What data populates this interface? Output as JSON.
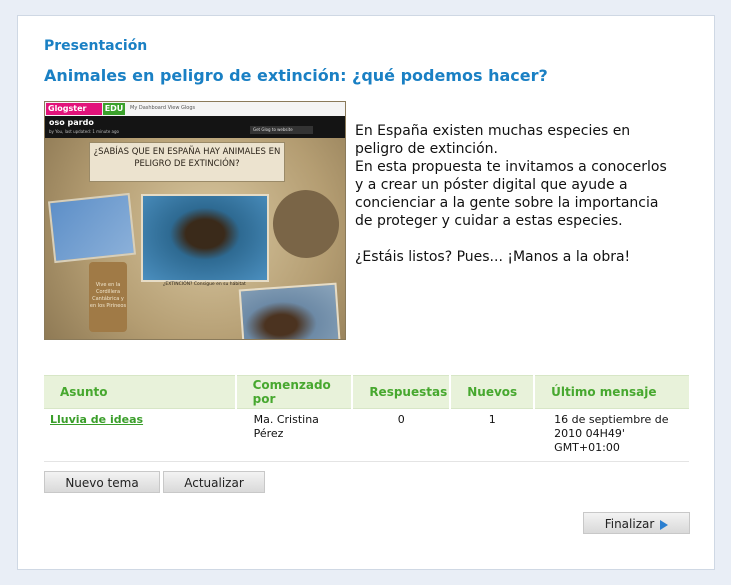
{
  "section": {
    "title": "Presentación"
  },
  "activity": {
    "title": "Animales en peligro de extinción: ¿qué podemos hacer?"
  },
  "poster": {
    "logo_text": "Glogster",
    "edu_text": "EDU",
    "nav_text": "My Dashboard   View Glogs",
    "glog_name": "oso pardo",
    "byline": "by You, last updated: 1 minute ago",
    "get_code": "Get Glog to website",
    "question": "¿SABÍAS QUE EN ESPAÑA HAY ANIMALES EN PELIGRO DE EXTINCIÓN?",
    "tag_text": "Vive en la Cordillera Cantábrica y en los Pirineos",
    "caption": "¿EXTINCIÓN? Consigue en su hábitat"
  },
  "description": {
    "paragraph1": "En España existen muchas especies en peligro de extinción.",
    "paragraph2": "En esta propuesta te invitamos a conocerlos y a crear un póster digital que ayude a concienciar a la gente sobre la importancia de proteger y cuidar a estas especies.",
    "paragraph3": "¿Estáis listos? Pues... ¡Manos a la obra!"
  },
  "table": {
    "headers": [
      "Asunto",
      "Comenzado por",
      "Respuestas",
      "Nuevos",
      "Último mensaje"
    ],
    "rows": [
      {
        "subject": "Lluvia de ideas",
        "author": "Ma. Cristina Pérez",
        "replies": "0",
        "new": "1",
        "last": "16 de septiembre de 2010 04H49' GMT+01:00"
      }
    ]
  },
  "buttons": {
    "new_topic": "Nuevo tema",
    "refresh": "Actualizar",
    "finish": "Finalizar"
  }
}
